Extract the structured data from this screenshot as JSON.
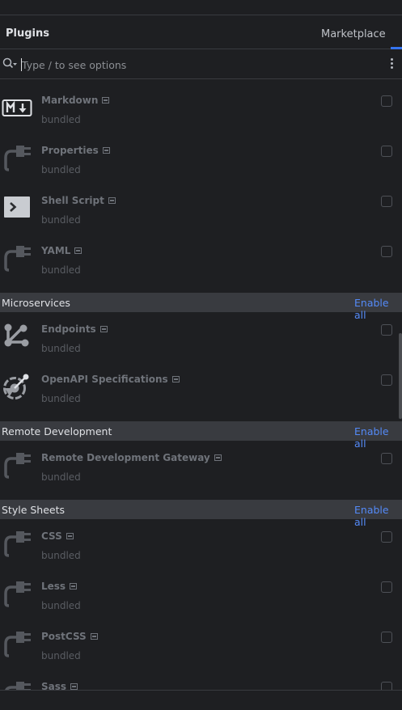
{
  "header": {
    "title": "Plugins",
    "tab_label": "Marketplace"
  },
  "search": {
    "placeholder": "Type / to see options"
  },
  "status": {
    "bundled": "bundled"
  },
  "plugins": {
    "markdown": {
      "name": "Markdown",
      "status": "bundled",
      "icon": "markdown-icon"
    },
    "properties": {
      "name": "Properties",
      "status": "bundled",
      "icon": "plugin-plug-icon"
    },
    "shell_script": {
      "name": "Shell Script",
      "status": "bundled",
      "icon": "terminal-icon"
    },
    "yaml": {
      "name": "YAML",
      "status": "bundled",
      "icon": "plugin-plug-icon"
    },
    "endpoints": {
      "name": "Endpoints",
      "status": "bundled",
      "icon": "endpoints-icon"
    },
    "openapi": {
      "name": "OpenAPI Specifications",
      "status": "bundled",
      "icon": "openapi-icon"
    },
    "remote_gateway": {
      "name": "Remote Development Gateway",
      "status": "bundled",
      "icon": "plugin-plug-icon"
    },
    "css": {
      "name": "CSS",
      "status": "bundled",
      "icon": "plugin-plug-icon"
    },
    "less": {
      "name": "Less",
      "status": "bundled",
      "icon": "plugin-plug-icon"
    },
    "postcss": {
      "name": "PostCSS",
      "status": "bundled",
      "icon": "plugin-plug-icon"
    },
    "sass": {
      "name": "Sass",
      "status": "bundled",
      "icon": "plugin-plug-icon"
    }
  },
  "groups": {
    "microservices": {
      "name": "Microservices",
      "action": "Enable all"
    },
    "remote_development": {
      "name": "Remote Development",
      "action": "Enable all"
    },
    "style_sheets": {
      "name": "Style Sheets",
      "action": "Enable all"
    }
  },
  "colors": {
    "background": "#1e1f22",
    "group_header": "#393b40",
    "link_accent": "#548af7",
    "tab_underline": "#3574f0",
    "disabled_text": "#6f737a"
  }
}
